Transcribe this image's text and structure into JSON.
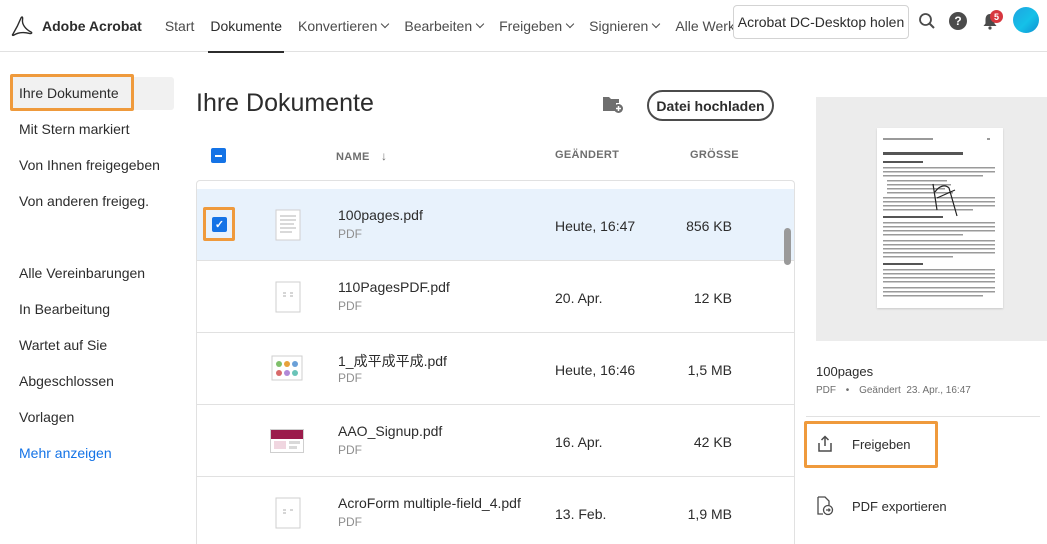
{
  "app": {
    "name": "Adobe Acrobat"
  },
  "nav": {
    "start": "Start",
    "documents": "Dokumente",
    "convert": "Konvertieren",
    "edit": "Bearbeiten",
    "share": "Freigeben",
    "sign": "Signieren",
    "all_tools": "Alle Werkzeuge"
  },
  "header": {
    "desktop_button": "Acrobat DC-Desktop holen",
    "notification_count": "5"
  },
  "sidebar": {
    "items": [
      {
        "label": "Ihre Dokumente"
      },
      {
        "label": "Mit Stern markiert"
      },
      {
        "label": "Von Ihnen freigegeben"
      },
      {
        "label": "Von anderen freigeg."
      },
      {
        "label": "Alle Vereinbarungen"
      },
      {
        "label": "In Bearbeitung"
      },
      {
        "label": "Wartet auf Sie"
      },
      {
        "label": "Abgeschlossen"
      },
      {
        "label": "Vorlagen"
      }
    ],
    "more": "Mehr anzeigen"
  },
  "main": {
    "title": "Ihre Dokumente",
    "upload_button": "Datei hochladen",
    "columns": {
      "name": "NAME",
      "changed": "GEÄNDERT",
      "size": "GRÖSSE"
    },
    "files": [
      {
        "name": "100pages.pdf",
        "type": "PDF",
        "date": "Heute, 16:47",
        "size": "856 KB"
      },
      {
        "name": "110PagesPDF.pdf",
        "type": "PDF",
        "date": "20. Apr.",
        "size": "12 KB"
      },
      {
        "name": "1_成平成平成.pdf",
        "type": "PDF",
        "date": "Heute, 16:46",
        "size": "1,5 MB"
      },
      {
        "name": "AAO_Signup.pdf",
        "type": "PDF",
        "date": "16. Apr.",
        "size": "42 KB"
      },
      {
        "name": "AcroForm multiple-field_4.pdf",
        "type": "PDF",
        "date": "13. Feb.",
        "size": "1,9 MB"
      }
    ]
  },
  "preview": {
    "title": "100pages",
    "type": "PDF",
    "separator": "•",
    "changed": "Geändert  23. Apr., 16:47",
    "actions": {
      "share": "Freigeben",
      "export": "PDF exportieren"
    }
  },
  "colors": {
    "accent": "#1473e6",
    "highlight": "#ef9a3c",
    "selected_row": "#e8f2fc"
  }
}
